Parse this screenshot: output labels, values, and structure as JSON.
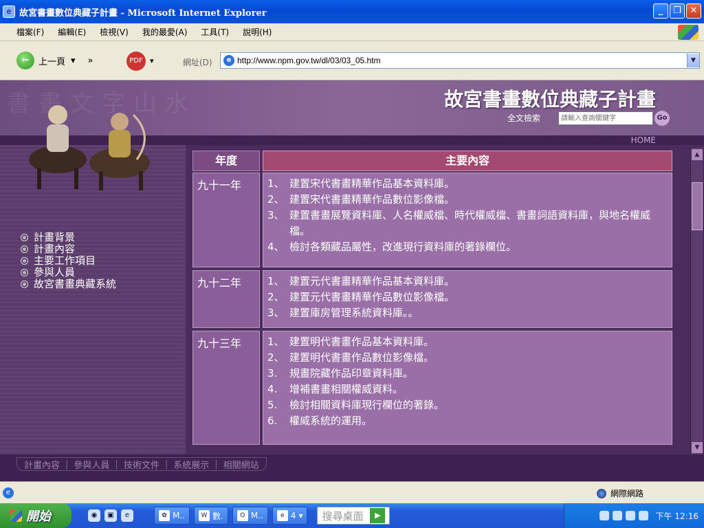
{
  "window": {
    "title": "故宮書畫數位典藏子計畫 - Microsoft Internet Explorer"
  },
  "menu": [
    "檔案(F)",
    "編輯(E)",
    "檢視(V)",
    "我的最愛(A)",
    "工具(T)",
    "說明(H)"
  ],
  "toolbar": {
    "back_label": "上一頁",
    "address_label": "網址(D)",
    "url": "http://www.npm.gov.tw/dl/03/03_05.htm"
  },
  "header": {
    "title": "故宮書畫數位典藏子計畫",
    "search_label": "全文檢索",
    "search_placeholder": "請輸入查詢關鍵字",
    "go_label": "Go",
    "home_label": "HOME"
  },
  "sidebar": {
    "items": [
      "計畫背景",
      "計畫內容",
      "主要工作項目",
      "參與人員",
      "故宮書畫典藏系統"
    ]
  },
  "table": {
    "headers": {
      "year": "年度",
      "content": "主要內容"
    },
    "rows": [
      {
        "year": "九十一年",
        "items": [
          {
            "num": "1、",
            "text": "建置宋代書畫精華作品基本資料庫。"
          },
          {
            "num": "2、",
            "text": "建置宋代書畫精華作品數位影像檔。"
          },
          {
            "num": "3、",
            "text": "建置書畫展覽資料庫、人名權威檔、時代權威檔、書畫詞語資料庫，與地名權威檔。"
          },
          {
            "num": "4、",
            "text": "檢討各類藏品屬性，改進現行資料庫的著錄欄位。"
          }
        ]
      },
      {
        "year": "九十二年",
        "items": [
          {
            "num": "1、",
            "text": "建置元代書畫精華作品基本資料庫。"
          },
          {
            "num": "2、",
            "text": "建置元代書畫精華作品數位影像檔。"
          },
          {
            "num": "3、",
            "text": "建置庫房管理系統資料庫。。"
          }
        ]
      },
      {
        "year": "九十三年",
        "items": [
          {
            "num": "1、",
            "text": "建置明代書畫作品基本資料庫。"
          },
          {
            "num": "2、",
            "text": "建置明代書畫作品數位影像檔。"
          },
          {
            "num": "3.",
            "text": "規畫院藏作品印章資料庫。"
          },
          {
            "num": "4.",
            "text": "增補書畫相關權威資料。"
          },
          {
            "num": "5.",
            "text": "檢討相關資料庫現行欄位的著錄。"
          },
          {
            "num": "6.",
            "text": "權威系統的運用。"
          }
        ]
      }
    ]
  },
  "bottom_nav": [
    "計畫內容",
    "參與人員",
    "技術文件",
    "系統展示",
    "相關網站"
  ],
  "status": {
    "zone": "網際網路"
  },
  "taskbar": {
    "start_label": "開始",
    "tasks": [
      "M..",
      "數.",
      "M..",
      "4"
    ],
    "search_label": "搜尋桌面",
    "clock": "下午 12:16"
  },
  "colors": {
    "purple_bg": "#5a3c6e",
    "header_accent": "#a44a71",
    "year_cell": "#8a5e98",
    "content_cell": "#9a6fa8"
  }
}
